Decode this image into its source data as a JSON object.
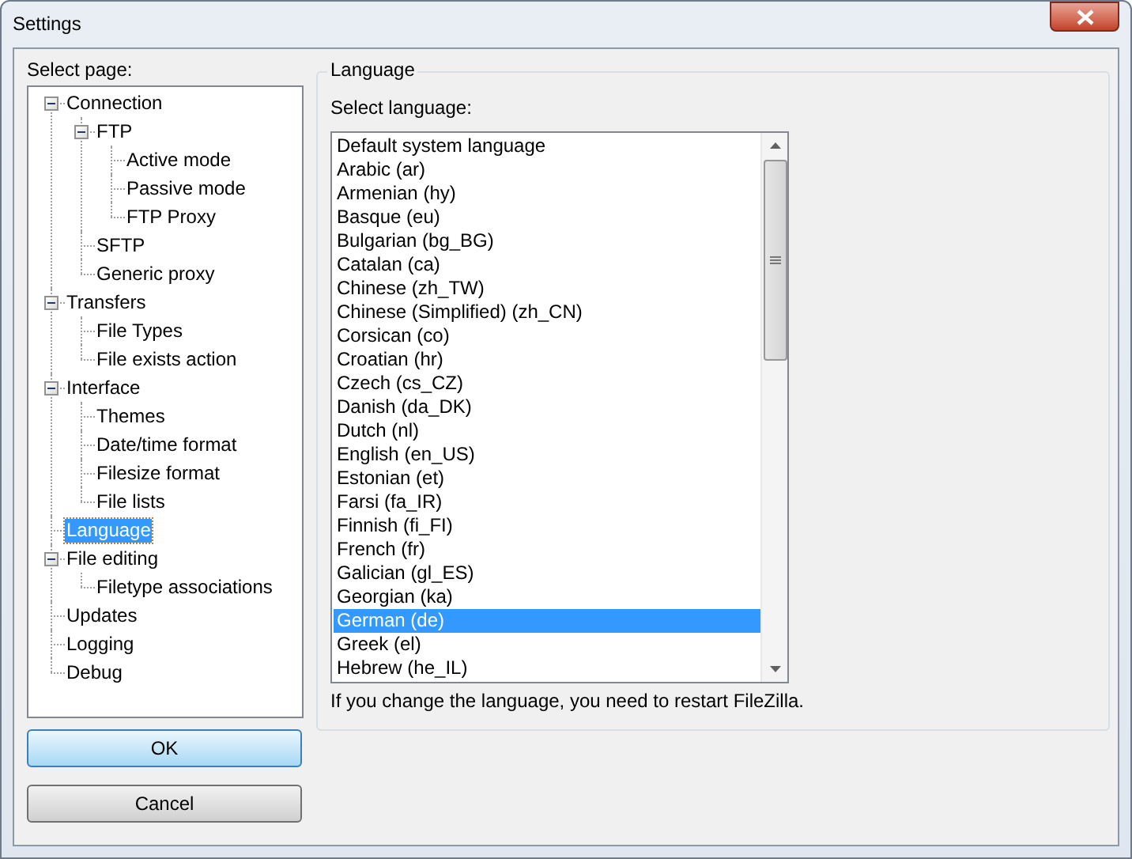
{
  "window": {
    "title": "Settings"
  },
  "page_tree": {
    "label": "Select page:",
    "items": [
      {
        "label": "Connection",
        "selected": false,
        "expanded": true,
        "children": [
          {
            "label": "FTP",
            "selected": false,
            "expanded": true,
            "children": [
              {
                "label": "Active mode",
                "selected": false
              },
              {
                "label": "Passive mode",
                "selected": false
              },
              {
                "label": "FTP Proxy",
                "selected": false
              }
            ]
          },
          {
            "label": "SFTP",
            "selected": false
          },
          {
            "label": "Generic proxy",
            "selected": false
          }
        ]
      },
      {
        "label": "Transfers",
        "selected": false,
        "expanded": true,
        "children": [
          {
            "label": "File Types",
            "selected": false
          },
          {
            "label": "File exists action",
            "selected": false
          }
        ]
      },
      {
        "label": "Interface",
        "selected": false,
        "expanded": true,
        "children": [
          {
            "label": "Themes",
            "selected": false
          },
          {
            "label": "Date/time format",
            "selected": false
          },
          {
            "label": "Filesize format",
            "selected": false
          },
          {
            "label": "File lists",
            "selected": false
          }
        ]
      },
      {
        "label": "Language",
        "selected": true
      },
      {
        "label": "File editing",
        "selected": false,
        "expanded": true,
        "children": [
          {
            "label": "Filetype associations",
            "selected": false
          }
        ]
      },
      {
        "label": "Updates",
        "selected": false
      },
      {
        "label": "Logging",
        "selected": false
      },
      {
        "label": "Debug",
        "selected": false
      }
    ]
  },
  "language_group": {
    "title": "Language",
    "list_label": "Select language:",
    "languages": [
      {
        "label": "Default system language",
        "selected": false
      },
      {
        "label": "Arabic (ar)",
        "selected": false
      },
      {
        "label": "Armenian (hy)",
        "selected": false
      },
      {
        "label": "Basque (eu)",
        "selected": false
      },
      {
        "label": "Bulgarian (bg_BG)",
        "selected": false
      },
      {
        "label": "Catalan (ca)",
        "selected": false
      },
      {
        "label": "Chinese (zh_TW)",
        "selected": false
      },
      {
        "label": "Chinese (Simplified) (zh_CN)",
        "selected": false
      },
      {
        "label": "Corsican (co)",
        "selected": false
      },
      {
        "label": "Croatian (hr)",
        "selected": false
      },
      {
        "label": "Czech (cs_CZ)",
        "selected": false
      },
      {
        "label": "Danish (da_DK)",
        "selected": false
      },
      {
        "label": "Dutch (nl)",
        "selected": false
      },
      {
        "label": "English (en_US)",
        "selected": false
      },
      {
        "label": "Estonian (et)",
        "selected": false
      },
      {
        "label": "Farsi (fa_IR)",
        "selected": false
      },
      {
        "label": "Finnish (fi_FI)",
        "selected": false
      },
      {
        "label": "French (fr)",
        "selected": false
      },
      {
        "label": "Galician (gl_ES)",
        "selected": false
      },
      {
        "label": "Georgian (ka)",
        "selected": false
      },
      {
        "label": "German (de)",
        "selected": true
      },
      {
        "label": "Greek (el)",
        "selected": false
      },
      {
        "label": "Hebrew (he_IL)",
        "selected": false
      }
    ],
    "note": "If you change the language, you need to restart FileZilla."
  },
  "buttons": [
    {
      "label": "OK",
      "default": true
    },
    {
      "label": "Cancel",
      "default": false
    }
  ]
}
